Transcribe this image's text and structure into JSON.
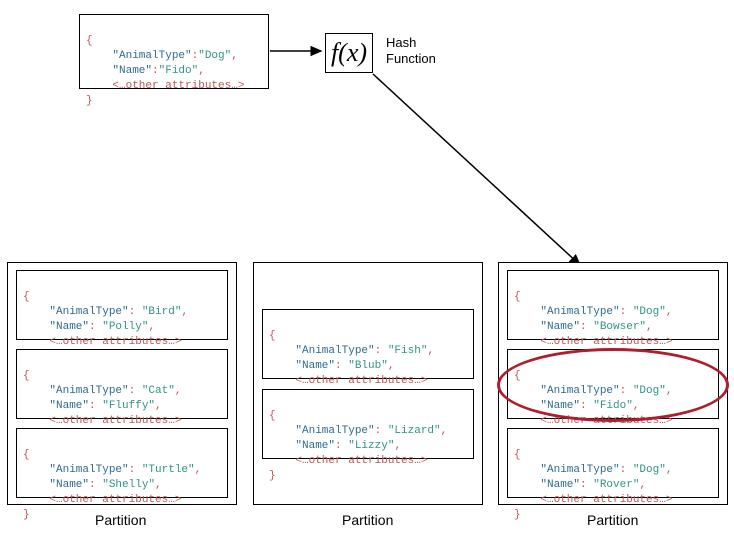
{
  "hash": {
    "fx": "f(x)",
    "label": "Hash\nFunction"
  },
  "keys": {
    "animalType": "\"AnimalType\"",
    "name": "\"Name\""
  },
  "other": "<…other attributes…>",
  "input": {
    "animalType": "\"Dog\"",
    "name": "\"Fido\""
  },
  "partitionLabel": "Partition",
  "partitions": [
    {
      "items": [
        {
          "animalType": "\"Bird\"",
          "name": "\"Polly\""
        },
        {
          "animalType": "\"Cat\"",
          "name": "\"Fluffy\""
        },
        {
          "animalType": "\"Turtle\"",
          "name": "\"Shelly\""
        }
      ]
    },
    {
      "items": [
        {
          "animalType": "\"Fish\"",
          "name": "\"Blub\""
        },
        {
          "animalType": "\"Lizard\"",
          "name": "\"Lizzy\""
        }
      ]
    },
    {
      "items": [
        {
          "animalType": "\"Dog\"",
          "name": "\"Bowser\""
        },
        {
          "animalType": "\"Dog\"",
          "name": "\"Fido\""
        },
        {
          "animalType": "\"Dog\"",
          "name": "\"Rover\""
        }
      ]
    }
  ]
}
